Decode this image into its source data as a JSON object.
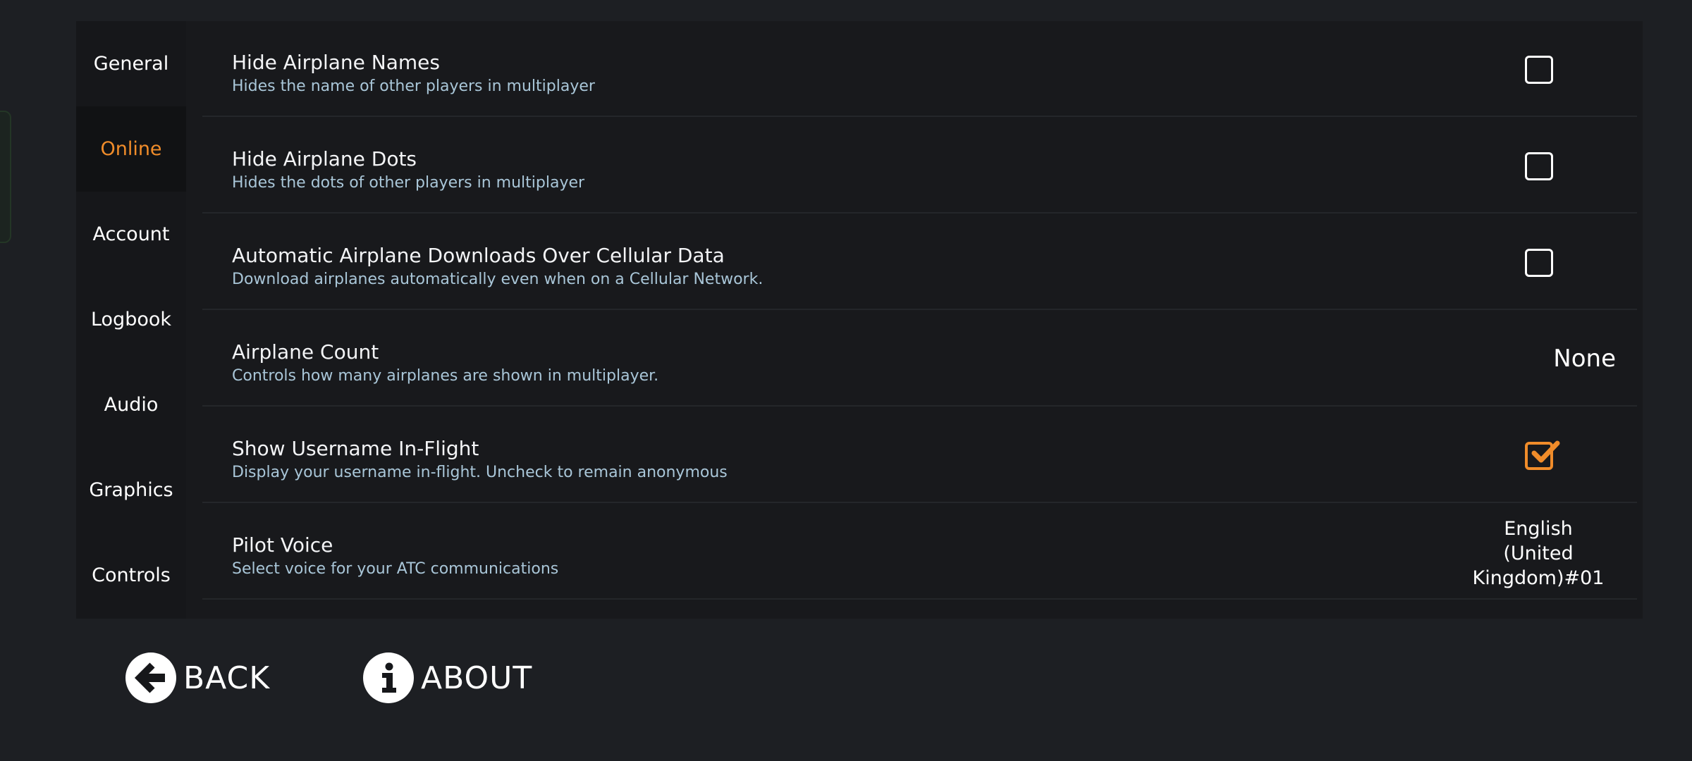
{
  "sidebar": {
    "tabs": [
      {
        "label": "General"
      },
      {
        "label": "Online"
      },
      {
        "label": "Account"
      },
      {
        "label": "Logbook"
      },
      {
        "label": "Audio"
      },
      {
        "label": "Graphics"
      },
      {
        "label": "Controls"
      }
    ],
    "active_tab": "Online"
  },
  "settings": {
    "rows": [
      {
        "title": "Hide Airplane Names",
        "description": "Hides the name of other players in multiplayer",
        "control": "checkbox",
        "checked": false
      },
      {
        "title": "Hide Airplane Dots",
        "description": "Hides the dots of other players in multiplayer",
        "control": "checkbox",
        "checked": false
      },
      {
        "title": "Automatic Airplane Downloads Over Cellular Data",
        "description": "Download airplanes automatically even when on a Cellular Network.",
        "control": "checkbox",
        "checked": false
      },
      {
        "title": "Airplane Count",
        "description": "Controls how many airplanes are shown in multiplayer.",
        "control": "value",
        "value": "None"
      },
      {
        "title": "Show Username In-Flight",
        "description": "Display your username in-flight. Uncheck to remain anonymous",
        "control": "checkbox",
        "checked": true
      },
      {
        "title": "Pilot Voice",
        "description": "Select voice for your ATC communications",
        "control": "value",
        "value_lines": [
          "English",
          "(United",
          "Kingdom)#01"
        ]
      }
    ]
  },
  "footer": {
    "back_label": "BACK",
    "about_label": "ABOUT"
  },
  "colors": {
    "accent": "#f08c2a",
    "background": "#1d1f23",
    "panel": "#18191c",
    "description_text": "#a9c6d8"
  },
  "icons": {
    "back": "arrow-left-circle-icon",
    "about": "info-circle-icon",
    "check": "checkmark-icon"
  }
}
